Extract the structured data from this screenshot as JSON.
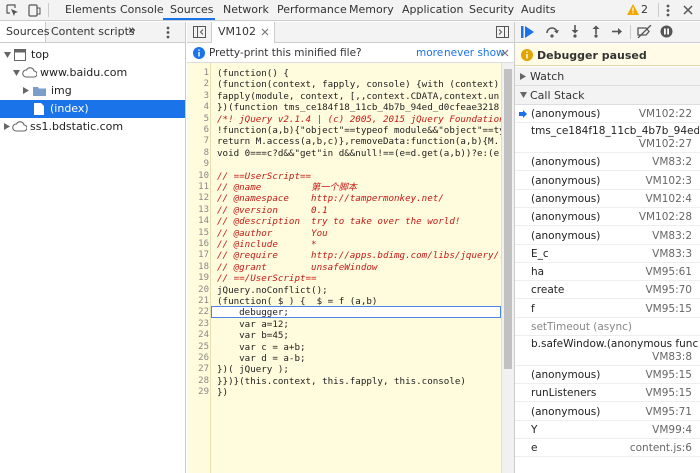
{
  "toolbar": {
    "tabs": [
      "Elements",
      "Console",
      "Sources",
      "Network",
      "Performance",
      "Memory",
      "Application",
      "Security",
      "Audits"
    ],
    "warning_count": "2"
  },
  "navigator": {
    "tabs": [
      "Sources",
      "Content scripts"
    ],
    "more": "»",
    "tree": [
      {
        "label": "top",
        "icon": "frame-icon"
      },
      {
        "label": "www.baidu.com",
        "icon": "cloud-icon"
      },
      {
        "label": "img",
        "icon": "folder-icon"
      },
      {
        "label": "(index)",
        "icon": "file-icon"
      },
      {
        "label": "ss1.bdstatic.com",
        "icon": "cloud-icon"
      }
    ]
  },
  "editor": {
    "file_tab": "VM102",
    "pretty_print": {
      "message": "Pretty-print this minified file?",
      "more": "more",
      "never": "never show"
    },
    "lines": [
      "(function() {",
      "(function(context, fapply, console) {with (context)",
      "fapply(module, context, [,,context.CDATA,context.un",
      "})(function tms_ce184f18_11cb_4b7b_94ed_d0cfeae3218",
      "/*! jQuery v2.1.4 | (c) 2005, 2015 jQuery Foundation",
      "!function(a,b){\"object\"==typeof module&&\"object\"==ty",
      "return M.access(a,b,c)},removeData:function(a,b){M.",
      "void 0===c?d&&\"get\"in d&&null!==(e=d.get(a,b))?e:(e",
      "",
      "// ==UserScript==",
      "// @name         第一个脚本",
      "// @namespace    http://tampermonkey.net/",
      "// @version      0.1",
      "// @description  try to take over the world!",
      "// @author       You",
      "// @include      *",
      "// @require      http://apps.bdimg.com/libs/jquery/.",
      "// @grant        unsafeWindow",
      "// ==/UserScript==",
      "jQuery.noConflict();",
      "(function( $ ) {  $ = f (a,b)",
      "    debugger;",
      "    var a=12;",
      "    var b=45;",
      "    var c = a+b;",
      "    var d = a-b;",
      "})( jQuery );",
      "}})}(this.context, this.fapply, this.console)",
      "})"
    ]
  },
  "debugger": {
    "paused_label": "Debugger paused",
    "watch_label": "Watch",
    "callstack_label": "Call Stack",
    "frames": [
      {
        "name": "(anonymous)",
        "loc": "VM102:22",
        "current": true
      },
      {
        "name": "tms_ce184f18_11cb_4b7b_94ed...",
        "loc": "VM102:27",
        "tall": true
      },
      {
        "name": "(anonymous)",
        "loc": "VM83:2"
      },
      {
        "name": "(anonymous)",
        "loc": "VM102:3"
      },
      {
        "name": "(anonymous)",
        "loc": "VM102:4"
      },
      {
        "name": "(anonymous)",
        "loc": "VM102:28"
      },
      {
        "name": "(anonymous)",
        "loc": "VM83:2"
      },
      {
        "name": "E_c",
        "loc": "VM83:3"
      },
      {
        "name": "ha",
        "loc": "VM95:61"
      },
      {
        "name": "create",
        "loc": "VM95:70"
      },
      {
        "name": "f",
        "loc": "VM95:15"
      },
      {
        "async": "setTimeout (async)"
      },
      {
        "name": "b.safeWindow.(anonymous func...",
        "loc": "VM83:8",
        "tall": true
      },
      {
        "name": "(anonymous)",
        "loc": "VM95:15"
      },
      {
        "name": "runListeners",
        "loc": "VM95:15"
      },
      {
        "name": "(anonymous)",
        "loc": "VM95:71"
      },
      {
        "name": "Y",
        "loc": "VM99:4"
      },
      {
        "name": "e",
        "loc": "content.js:6"
      }
    ]
  },
  "colors": {
    "accent": "#1a73e8",
    "paused_bg": "#fffbe6",
    "code_bg": "#fffbdd"
  }
}
